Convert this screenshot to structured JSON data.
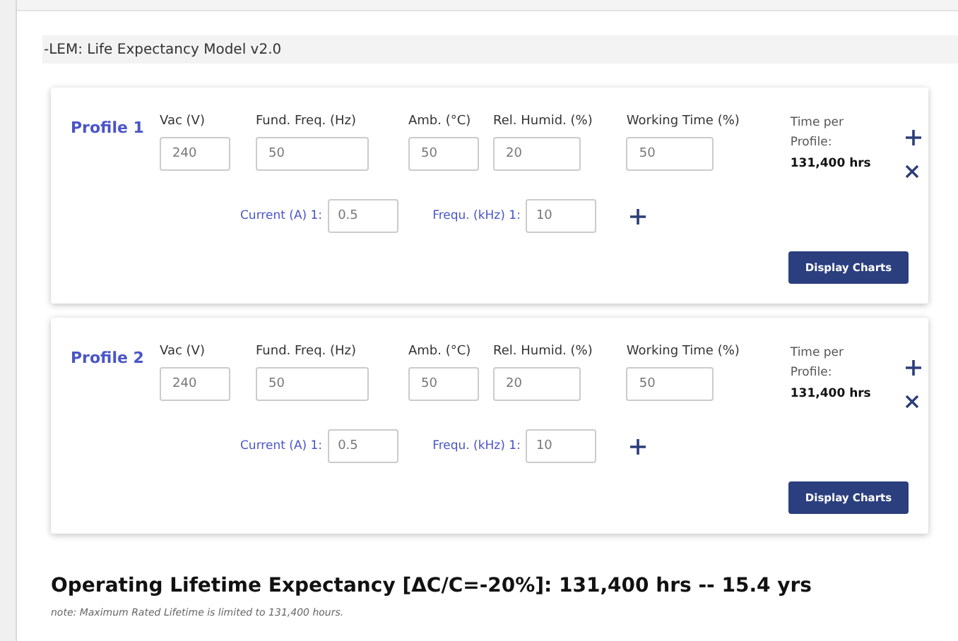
{
  "header": {
    "title": "-LEM: Life Expectancy Model v2.0"
  },
  "profiles": [
    {
      "name": "Profile 1",
      "fields": [
        {
          "label": "Vac (V)",
          "value": "240"
        },
        {
          "label": "Fund. Freq. (Hz)",
          "value": "50"
        },
        {
          "label": "Amb. (°C)",
          "value": "50"
        },
        {
          "label": "Rel. Humid. (%)",
          "value": "20"
        },
        {
          "label": "Working Time (%)",
          "value": "50"
        }
      ],
      "time_label": "Time per Profile:",
      "time_value": "131,400 hrs",
      "harmonics": [
        {
          "current_label": "Current (A) 1:",
          "current": "0.5",
          "freq_label": "Frequ. (kHz) 1:",
          "freq": "10"
        }
      ],
      "button": "Display Charts"
    },
    {
      "name": "Profile 2",
      "fields": [
        {
          "label": "Vac (V)",
          "value": "240"
        },
        {
          "label": "Fund. Freq. (Hz)",
          "value": "50"
        },
        {
          "label": "Amb. (°C)",
          "value": "50"
        },
        {
          "label": "Rel. Humid. (%)",
          "value": "20"
        },
        {
          "label": "Working Time (%)",
          "value": "50"
        }
      ],
      "time_label": "Time per Profile:",
      "time_value": "131,400 hrs",
      "harmonics": [
        {
          "current_label": "Current (A) 1:",
          "current": "0.5",
          "freq_label": "Frequ. (kHz) 1:",
          "freq": "10"
        }
      ],
      "button": "Display Charts"
    }
  ],
  "result": {
    "heading": "Operating Lifetime Expectancy [ΔC/C=-20%]: 131,400 hrs -- 15.4 yrs",
    "note": "note: Maximum Rated Lifetime is limited to 131,400 hours."
  }
}
